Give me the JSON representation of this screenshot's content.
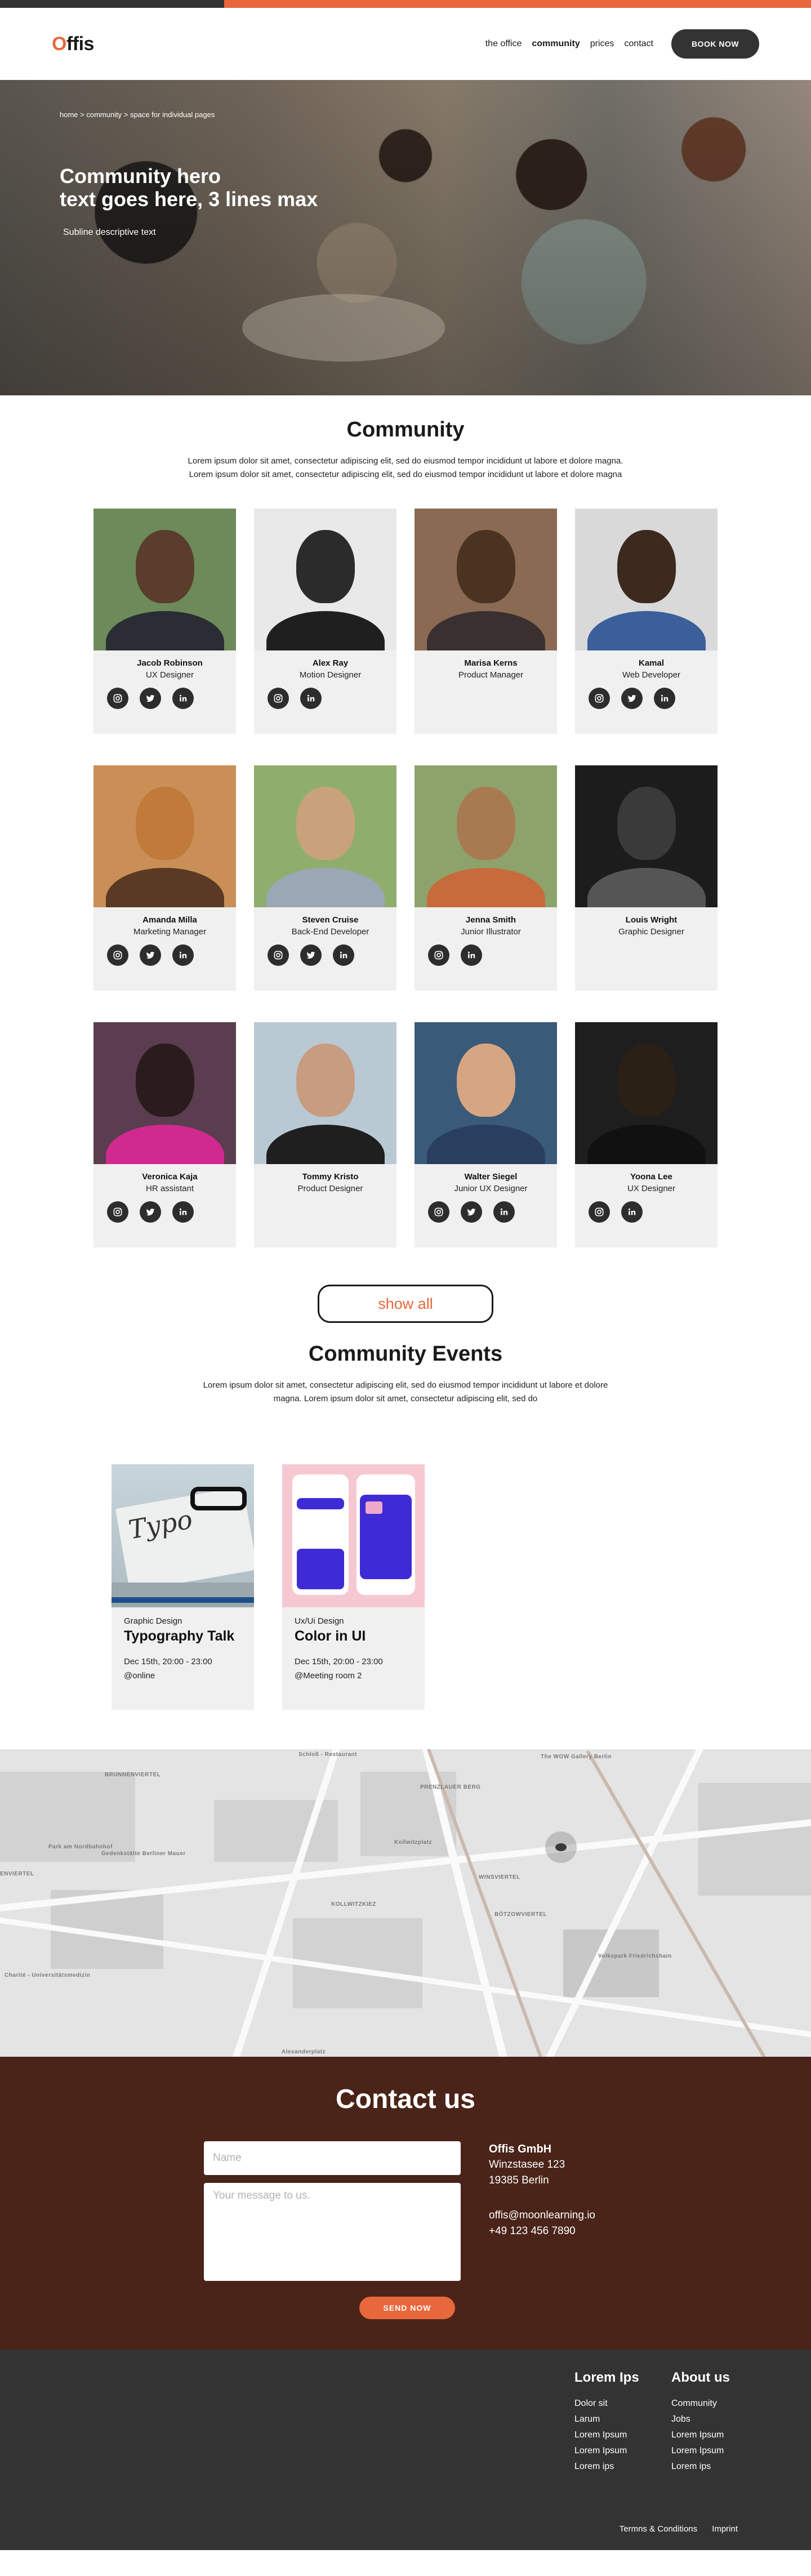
{
  "brand": {
    "logo_first": "O",
    "logo_rest": "ffis",
    "accent": "#e8673c",
    "dark": "#333333",
    "contact_bg": "#4a2419"
  },
  "nav": {
    "links": [
      "the office",
      "community",
      "prices",
      "contact"
    ],
    "active": "community",
    "book_label": "BOOK NOW"
  },
  "hero": {
    "breadcrumb": "home > community > space for individual pages",
    "title_line1": "Community hero",
    "title_line2": "text goes here, 3 lines max",
    "subline": "Subline descriptive text"
  },
  "community": {
    "title": "Community",
    "description": "Lorem ipsum dolor sit amet, consectetur adipiscing elit, sed do eiusmod tempor incididunt ut labore et dolore magna. Lorem ipsum dolor sit amet, consectetur adipiscing elit, sed do eiusmod tempor incididunt ut labore et dolore magna",
    "members": [
      {
        "name": "Jacob Robinson",
        "role": "UX Designer",
        "socials": [
          "instagram-icon",
          "twitter-icon",
          "linkedin-icon"
        ]
      },
      {
        "name": "Alex Ray",
        "role": "Motion Designer",
        "socials": [
          "instagram-icon",
          "linkedin-icon"
        ]
      },
      {
        "name": "Marisa Kerns",
        "role": "Product Manager",
        "socials": []
      },
      {
        "name": "Kamal",
        "role": "Web Developer",
        "socials": [
          "instagram-icon",
          "twitter-icon",
          "linkedin-icon"
        ]
      },
      {
        "name": "Amanda Milla",
        "role": "Marketing Manager",
        "socials": [
          "instagram-icon",
          "twitter-icon",
          "linkedin-icon"
        ]
      },
      {
        "name": "Steven Cruise",
        "role": "Back-End Developer",
        "socials": [
          "instagram-icon",
          "twitter-icon",
          "linkedin-icon"
        ]
      },
      {
        "name": "Jenna Smith",
        "role": "Junior Illustrator",
        "socials": [
          "instagram-icon",
          "linkedin-icon"
        ]
      },
      {
        "name": "Louis Wright",
        "role": "Graphic Designer",
        "socials": []
      },
      {
        "name": "Veronica Kaja",
        "role": "HR assistant",
        "socials": [
          "instagram-icon",
          "twitter-icon",
          "linkedin-icon"
        ]
      },
      {
        "name": "Tommy  Kristo",
        "role": "Product Designer",
        "socials": []
      },
      {
        "name": "Walter Siegel",
        "role": "Junior UX Designer",
        "socials": [
          "instagram-icon",
          "twitter-icon",
          "linkedin-icon"
        ]
      },
      {
        "name": "Yoona Lee",
        "role": "UX Designer",
        "socials": [
          "instagram-icon",
          "linkedin-icon"
        ]
      }
    ],
    "show_all_label": "show all"
  },
  "events": {
    "title": "Community Events",
    "description": "Lorem ipsum dolor sit amet, consectetur adipiscing elit, sed do eiusmod tempor incididunt ut labore et dolore magna. Lorem ipsum dolor sit amet, consectetur adipiscing elit, sed do",
    "items": [
      {
        "category": "Graphic Design",
        "title": "Typography Talk",
        "date": "Dec 15th, 20:00 - 23:00",
        "place": "@online"
      },
      {
        "category": "Ux/Ui Design",
        "title": "Color in UI",
        "date": "Dec 15th, 20:00 - 23:00",
        "place": "@Meeting room 2"
      }
    ]
  },
  "map": {
    "labels": [
      "Schloß - Restaurant",
      "BRUNNENVIERTEL",
      "The WOW Gallery Berlin",
      "PRENZLAUER BERG",
      "Park am Nordbahnhof",
      "Gedenkstätte Berliner Mauer",
      "Kollwitzplatz",
      "ENVIERTEL",
      "KOLLWITZKIEZ",
      "WINSVIERTEL",
      "BÖTZOWVIERTEL",
      "Volkspark Friedrichshain",
      "Charité - Universitätsmedizin",
      "Alexanderplatz"
    ]
  },
  "contact": {
    "title": "Contact us",
    "name_placeholder": "Name",
    "message_placeholder": "Your message to us.",
    "send_label": "SEND NOW",
    "company": "Offis GmbH",
    "street": "Winzstasee 123",
    "city": "19385 Berlin",
    "email": "offis@moonlearning.io",
    "phone": "+49 123 456 7890"
  },
  "footer": {
    "col1": {
      "title": "Lorem Ips",
      "links": [
        "Dolor sit",
        "Larum",
        "Lorem Ipsum",
        "Lorem Ipsum",
        "Lorem ips"
      ]
    },
    "col2": {
      "title": "About us",
      "links": [
        "Community",
        "Jobs",
        "Lorem Ipsum",
        "Lorem Ipsum",
        "Lorem ips"
      ]
    },
    "legal": [
      "Termns & Conditions",
      "Imprint"
    ]
  }
}
